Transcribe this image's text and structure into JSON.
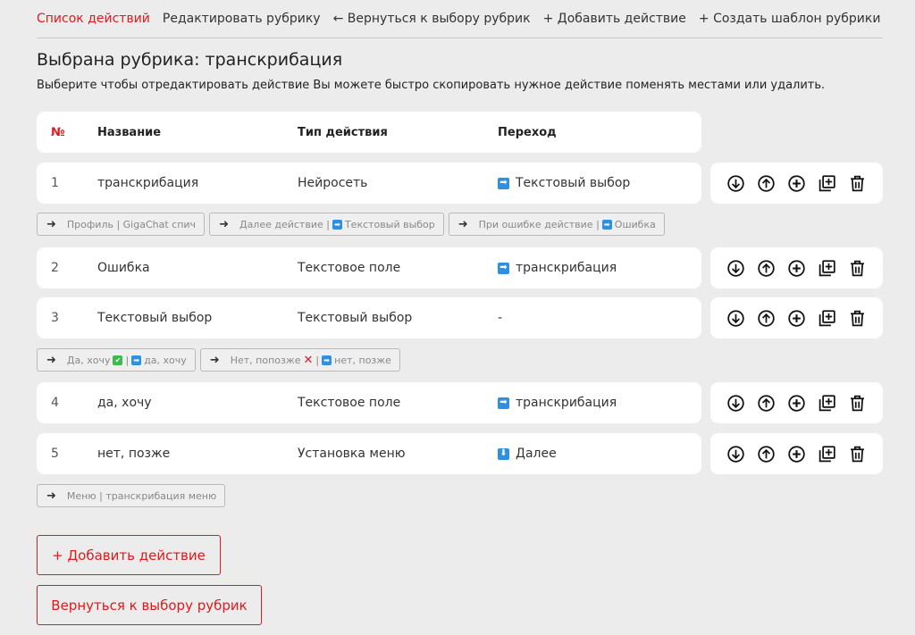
{
  "nav": {
    "items": [
      {
        "label": "Список действий",
        "active": true
      },
      {
        "label": "Редактировать рубрику",
        "active": false
      },
      {
        "label": "← Вернуться к выбору рубрик",
        "active": false
      },
      {
        "label": "+ Добавить действие",
        "active": false
      },
      {
        "label": "+ Создать шаблон рубрики",
        "active": false
      }
    ]
  },
  "page": {
    "title": "Выбрана рубрика: транскрибация",
    "description": "Выберите чтобы отредактировать действие Вы можете быстро скопировать нужное действие поменять местами или удалить."
  },
  "table": {
    "headers": {
      "num": "№",
      "name": "Название",
      "type": "Тип действия",
      "transition": "Переход"
    },
    "rows": [
      {
        "num": "1",
        "name": "транскрибация",
        "type": "Нейросеть",
        "transition": "Текстовый выбор",
        "transition_icon": "arrow-right-icon"
      },
      {
        "num": "2",
        "name": "Ошибка",
        "type": "Текстовое поле",
        "transition": "транскрибация",
        "transition_icon": "arrow-right-icon"
      },
      {
        "num": "3",
        "name": "Текстовый выбор",
        "type": "Текстовый выбор",
        "transition": "-",
        "transition_icon": ""
      },
      {
        "num": "4",
        "name": "да, хочу",
        "type": "Текстовое поле",
        "transition": "транскрибация",
        "transition_icon": "arrow-right-icon"
      },
      {
        "num": "5",
        "name": "нет, позже",
        "type": "Установка меню",
        "transition": "Далее",
        "transition_icon": "arrow-down-icon"
      }
    ]
  },
  "chips": {
    "row1": [
      {
        "a": "Профиль | GigaChat спич",
        "b": ""
      },
      {
        "a": "Далее действие |",
        "b": "Текстовый выбор"
      },
      {
        "a": "При ошибке действие |",
        "b": "Ошибка"
      }
    ],
    "row3": [
      {
        "a": "Да, хочу",
        "b": "да, хочу"
      },
      {
        "a": "Нет, попозже",
        "b": "нет, позже"
      }
    ],
    "row5": [
      {
        "a": "Меню | транскрибация меню",
        "b": ""
      }
    ]
  },
  "buttons": {
    "add_action": "+ Добавить действие",
    "back": "Вернуться к выбору рубрик"
  },
  "colors": {
    "accent": "#e0191d",
    "blue": "#2f8fe0",
    "green": "#3dbb4e"
  }
}
